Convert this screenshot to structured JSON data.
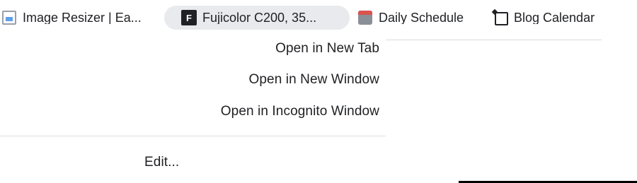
{
  "bookmarks_bar": {
    "items": [
      {
        "label": "Image Resizer | Ea...",
        "icon": "image-icon"
      },
      {
        "label": "Fujicolor C200, 35...",
        "icon": "film-icon",
        "favicon_text": "F"
      },
      {
        "label": "Daily Schedule",
        "icon": "calendar-icon"
      },
      {
        "label": "Blog Calendar",
        "icon": "blog-icon"
      }
    ]
  },
  "context_menu": {
    "items": [
      {
        "label": "Open in New Tab"
      },
      {
        "label": "Open in New Window"
      },
      {
        "label": "Open in Incognito Window"
      }
    ],
    "edit_label": "Edit..."
  },
  "colors": {
    "hover_chip": "#e8eaed",
    "separator": "#dadce0",
    "text": "#202124"
  }
}
